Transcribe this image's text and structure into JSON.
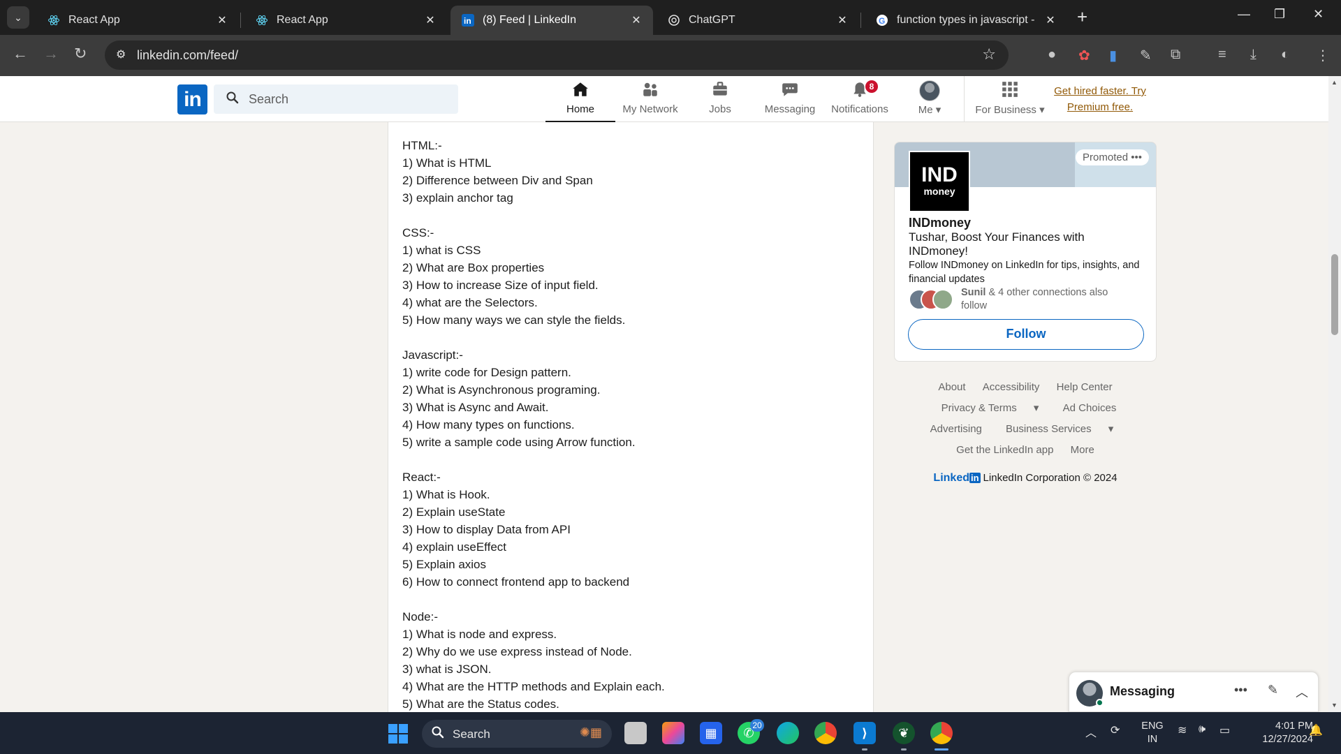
{
  "browser": {
    "tabs": [
      {
        "title": "React App",
        "icon": "react-icon",
        "active": false
      },
      {
        "title": "React App",
        "icon": "react-icon",
        "active": false
      },
      {
        "title": "(8) Feed | LinkedIn",
        "icon": "linkedin-icon",
        "active": true
      },
      {
        "title": "ChatGPT",
        "icon": "chatgpt-icon",
        "active": false
      },
      {
        "title": "function types in javascript - Go",
        "icon": "google-icon",
        "active": false
      }
    ],
    "url": "linkedin.com/feed/"
  },
  "linkedin": {
    "logo_text": "in",
    "search_placeholder": "Search",
    "nav": {
      "home": "Home",
      "network": "My Network",
      "jobs": "Jobs",
      "messaging": "Messaging",
      "notifications": "Notifications",
      "notifications_count": "8",
      "me": "Me",
      "business": "For Business"
    },
    "premium_line1": "Get hired faster. Try",
    "premium_line2": "Premium free."
  },
  "post": {
    "lines": [
      "HTML:-",
      "1) What is HTML",
      "2) Difference between Div and Span",
      "3) explain anchor tag",
      "",
      "CSS:-",
      "1) what is CSS",
      "2) What are Box properties",
      "3) How to increase Size of input field.",
      "4) what are the Selectors.",
      "5) How many ways we can style the fields.",
      "",
      "Javascript:-",
      "1) write code for Design pattern.",
      "2) What is Asynchronous programing.",
      "3) What is Async and Await.",
      "4) How many types on functions.",
      "5) write a sample code using Arrow function.",
      "",
      "React:-",
      "1) What is Hook.",
      "2) Explain useState",
      "3) How to display Data from API",
      "4) explain useEffect",
      "5) Explain axios",
      "6) How to connect frontend app to backend",
      "",
      "Node:-",
      "1) What is node and express.",
      "2) Why do we use express instead of Node.",
      "3) what is JSON.",
      "4) What are the HTTP methods and Explain each.",
      "5) What are the Status codes."
    ]
  },
  "ad": {
    "promoted": "Promoted",
    "logo_top": "IND",
    "logo_bottom": "money",
    "name": "INDmoney",
    "headline": "Tushar, Boost Your Finances with INDmoney!",
    "description": "Follow INDmoney on LinkedIn for tips, insights, and financial updates",
    "connection_name": "Sunil",
    "connection_text": " & 4 other connections also follow",
    "follow": "Follow"
  },
  "footer": {
    "about": "About",
    "accessibility": "Accessibility",
    "help": "Help Center",
    "privacy": "Privacy & Terms",
    "adchoices": "Ad Choices",
    "advertising": "Advertising",
    "business": "Business Services",
    "getapp": "Get the LinkedIn app",
    "more": "More",
    "brand": "Linked",
    "brand_in": "in",
    "copyright": "LinkedIn Corporation © 2024"
  },
  "messaging": {
    "label": "Messaging"
  },
  "taskbar": {
    "search": "Search",
    "whatsapp_badge": "20",
    "lang1": "ENG",
    "lang2": "IN",
    "time": "4:01 PM",
    "date": "12/27/2024"
  },
  "colors": {
    "linkedin_blue": "#0a66c2",
    "notification_red": "#cb112d",
    "premium_gold": "#915907"
  }
}
